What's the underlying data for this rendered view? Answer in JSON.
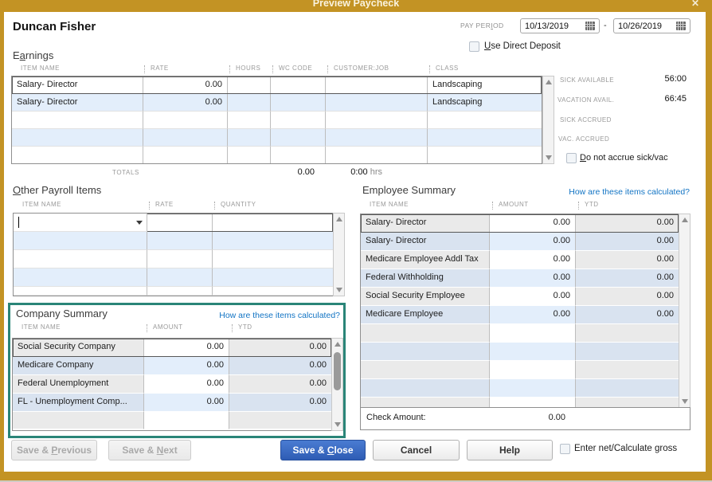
{
  "window": {
    "title": "Preview Paycheck",
    "close_icon": "✕"
  },
  "header": {
    "employee_name": "Duncan Fisher",
    "pay_period_label": {
      "pre": "PAY PER",
      "key": "I",
      "post": "OD"
    },
    "date_from": "10/13/2019",
    "date_separator": "-",
    "date_to": "10/26/2019",
    "use_direct_deposit": {
      "pre": "",
      "key": "U",
      "post": "se Direct Deposit"
    }
  },
  "earnings": {
    "title": {
      "pre": "E",
      "key": "a",
      "post": "rnings"
    },
    "columns": [
      "ITEM NAME",
      "RATE",
      "HOURS",
      "WC CODE",
      "CUSTOMER:JOB",
      "CLASS"
    ],
    "rows": [
      {
        "item_name": "Salary- Director",
        "rate": "0.00",
        "hours": "",
        "wc_code": "",
        "customer_job": "",
        "class": "Landscaping"
      },
      {
        "item_name": "Salary- Director",
        "rate": "0.00",
        "hours": "",
        "wc_code": "",
        "customer_job": "",
        "class": "Landscaping"
      }
    ],
    "totals_label": "TOTALS",
    "totals_amount": "0.00",
    "totals_hours": "0:00",
    "totals_hours_unit": "hrs"
  },
  "accruals": {
    "rows": [
      {
        "label": "SICK AVAILABLE",
        "value": "56:00"
      },
      {
        "label": "VACATION AVAIL.",
        "value": "66:45"
      },
      {
        "label": "SICK ACCRUED",
        "value": ""
      },
      {
        "label": "VAC. ACCRUED",
        "value": ""
      }
    ],
    "do_not_accrue": {
      "pre": "",
      "key": "D",
      "post": "o not accrue sick/vac"
    }
  },
  "other_payroll_items": {
    "title": {
      "pre": "",
      "key": "O",
      "post": "ther Payroll Items"
    },
    "columns": [
      "ITEM NAME",
      "RATE",
      "QUANTITY"
    ]
  },
  "employee_summary": {
    "title": "Employee Summary",
    "link": "How are these items calculated?",
    "columns": [
      "ITEM NAME",
      "AMOUNT",
      "YTD"
    ],
    "rows": [
      {
        "item_name": "Salary- Director",
        "amount": "0.00",
        "ytd": "0.00"
      },
      {
        "item_name": "Salary- Director",
        "amount": "0.00",
        "ytd": "0.00"
      },
      {
        "item_name": "Medicare Employee Addl Tax",
        "amount": "0.00",
        "ytd": "0.00"
      },
      {
        "item_name": "Federal Withholding",
        "amount": "0.00",
        "ytd": "0.00"
      },
      {
        "item_name": "Social Security Employee",
        "amount": "0.00",
        "ytd": "0.00"
      },
      {
        "item_name": "Medicare Employee",
        "amount": "0.00",
        "ytd": "0.00"
      }
    ],
    "check_amount_label": "Check Amount:",
    "check_amount_value": "0.00"
  },
  "company_summary": {
    "title": "Company Summary",
    "link": "How are these items calculated?",
    "columns": [
      "ITEM NAME",
      "AMOUNT",
      "YTD"
    ],
    "rows": [
      {
        "item_name": "Social Security Company",
        "amount": "0.00",
        "ytd": "0.00"
      },
      {
        "item_name": "Medicare Company",
        "amount": "0.00",
        "ytd": "0.00"
      },
      {
        "item_name": "Federal Unemployment",
        "amount": "0.00",
        "ytd": "0.00"
      },
      {
        "item_name": "FL - Unemployment Comp...",
        "amount": "0.00",
        "ytd": "0.00"
      }
    ]
  },
  "footer": {
    "save_previous": {
      "pre": "Save & ",
      "key": "P",
      "post": "revious"
    },
    "save_next": {
      "pre": "Save & ",
      "key": "N",
      "post": "ext"
    },
    "save_close": {
      "pre": "Save & ",
      "key": "C",
      "post": "lose"
    },
    "cancel": "Cancel",
    "help": "Help",
    "enter_net": {
      "pre": "Enter net/Calculate ",
      "key": "g",
      "post": "ross"
    }
  },
  "colors": {
    "titlebar_gold": "#C39324",
    "highlight_teal": "#2A8578",
    "link_blue": "#1274C4",
    "primary_button_blue": "#3765C0"
  }
}
